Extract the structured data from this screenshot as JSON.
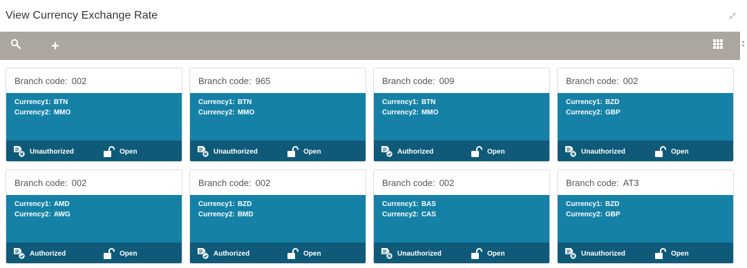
{
  "header": {
    "title": "View Currency Exchange Rate"
  },
  "icons": {
    "search": "search-icon",
    "add": "plus-icon",
    "grid": "grid-view-icon",
    "collapse": "shrink-icon",
    "lock": "padlock-open-icon",
    "doc_unauth": "document-unauthorized-icon",
    "doc_auth": "document-authorized-icon"
  },
  "toolbar": {
    "add_glyph": "+"
  },
  "labels": {
    "branch_code": "Branch code:",
    "currency1": "Currency1:",
    "currency2": "Currency2:",
    "open": "Open"
  },
  "cards": [
    {
      "branch": "002",
      "currency1": "BTN",
      "currency2": "MMO",
      "status": "Unauthorized"
    },
    {
      "branch": "965",
      "currency1": "BTN",
      "currency2": "MMO",
      "status": "Unauthorized"
    },
    {
      "branch": "009",
      "currency1": "BTN",
      "currency2": "MMO",
      "status": "Authorized"
    },
    {
      "branch": "002",
      "currency1": "BZD",
      "currency2": "GBP",
      "status": "Unauthorized"
    },
    {
      "branch": "002",
      "currency1": "AMD",
      "currency2": "AWG",
      "status": "Authorized"
    },
    {
      "branch": "002",
      "currency1": "BZD",
      "currency2": "BMD",
      "status": "Authorized"
    },
    {
      "branch": "002",
      "currency1": "BAS",
      "currency2": "CAS",
      "status": "Unauthorized"
    },
    {
      "branch": "AT3",
      "currency1": "BZD",
      "currency2": "GBP",
      "status": "Unauthorized"
    }
  ],
  "colors": {
    "toolbar_bg": "#aba7a0",
    "card_body": "#1581a7",
    "card_footer": "#0f5a78"
  }
}
